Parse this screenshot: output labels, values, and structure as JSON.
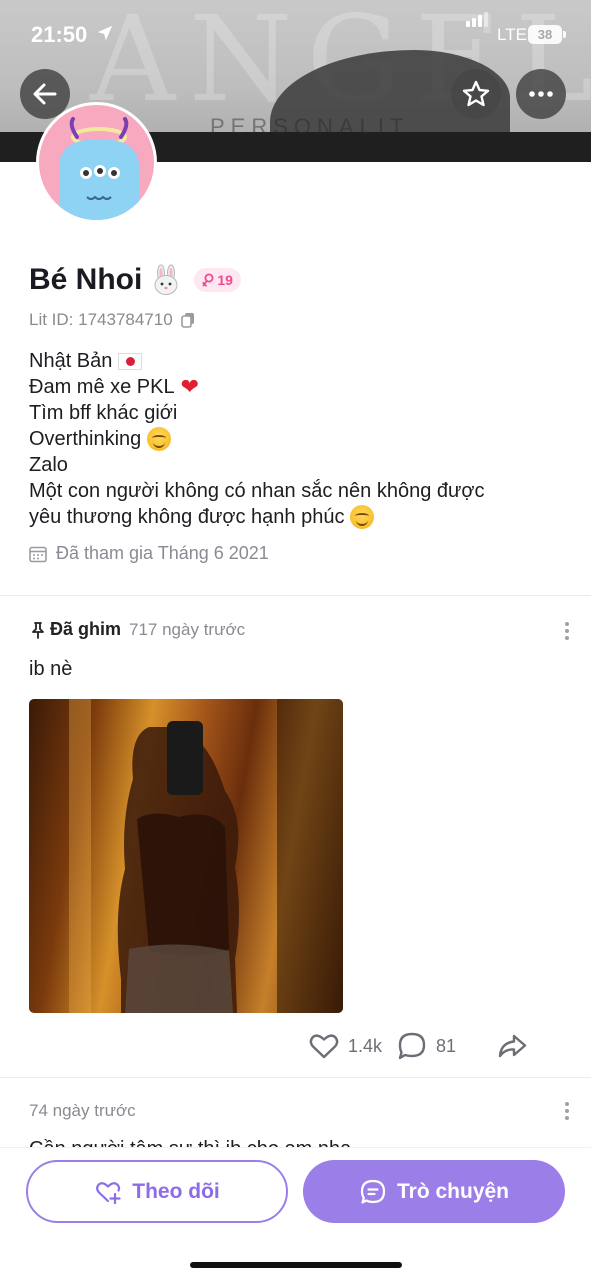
{
  "status_bar": {
    "time": "21:50",
    "network": "LTE",
    "battery": "38"
  },
  "cover": {
    "letters": "ANGEL",
    "caption": "PERSONALIT"
  },
  "nav": {
    "back_icon": "arrow-left-icon",
    "favorite_icon": "star-icon",
    "more_icon": "more-horizontal-icon"
  },
  "profile": {
    "name": "Bé Nhoi",
    "name_emoji": "rabbit-face",
    "age_badge": "19",
    "lit_id": "Lit ID: 1743784710",
    "bio": [
      "Nhật Bản",
      "Đam mê xe PKL",
      "Tìm bff khác giới",
      "Overthinking",
      "Zalo",
      "Một con người không có nhan sắc nên không được",
      "yêu thương không được hạnh phúc"
    ],
    "joined": "Đã tham gia Tháng 6 2021"
  },
  "posts": [
    {
      "pinned_label": "Đã ghim",
      "time": "717 ngày trước",
      "text": "ib nè",
      "likes": "1.4k",
      "comments": "81"
    },
    {
      "time": "74 ngày trước",
      "text": "Cần người tâm sự thì ib cho em nha"
    }
  ],
  "buttons": {
    "follow": "Theo dõi",
    "chat": "Trò chuyện"
  },
  "colors": {
    "accent": "#9b7ee8",
    "badge_pink": "#ef4c8f",
    "avatar_bg": "#f7a9c0",
    "avatar_monster": "#8fd3f4"
  }
}
